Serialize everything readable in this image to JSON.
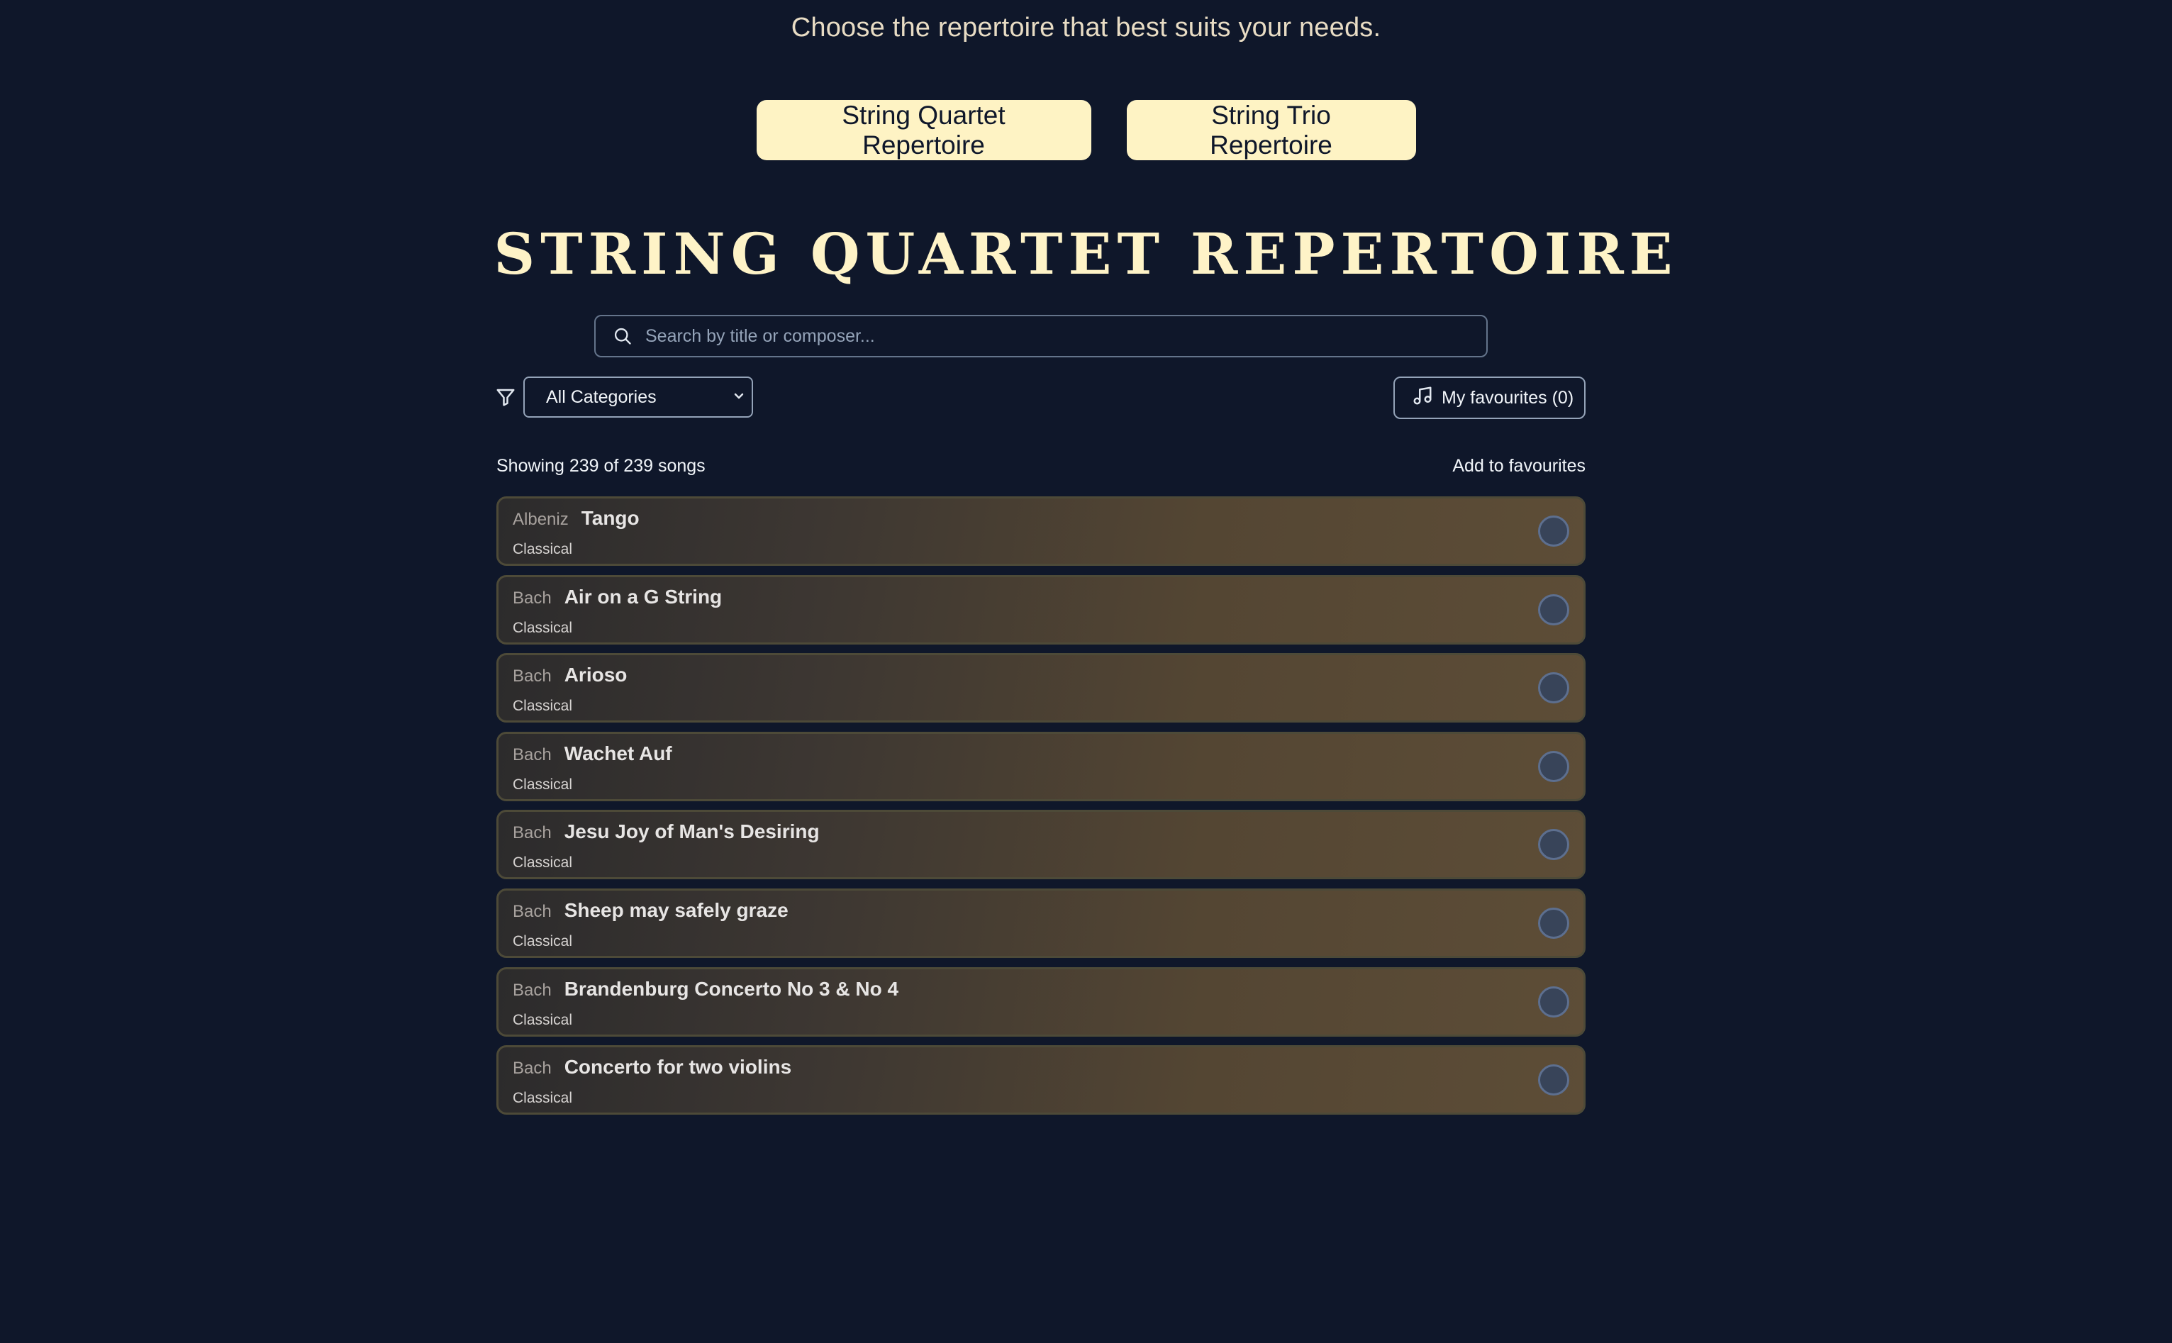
{
  "header": {
    "subtitle": "Choose the repertoire that best suits your needs."
  },
  "repertoire_buttons": [
    {
      "label": "String Quartet Repertoire"
    },
    {
      "label": "String Trio Repertoire"
    }
  ],
  "section": {
    "title": "STRING QUARTET REPERTOIRE"
  },
  "search": {
    "placeholder": "Search by title or composer...",
    "value": ""
  },
  "filter": {
    "icon": "filter-icon",
    "selected": "All Categories"
  },
  "favourites": {
    "icon": "music-note-icon",
    "label": "My favourites (0)"
  },
  "list": {
    "count_text": "Showing 239 of 239 songs",
    "add_to_favourites_label": "Add to favourites",
    "songs": [
      {
        "composer": "Albeniz",
        "title": "Tango",
        "category": "Classical"
      },
      {
        "composer": "Bach",
        "title": "Air on a G String",
        "category": "Classical"
      },
      {
        "composer": "Bach",
        "title": "Arioso",
        "category": "Classical"
      },
      {
        "composer": "Bach",
        "title": "Wachet Auf",
        "category": "Classical"
      },
      {
        "composer": "Bach",
        "title": "Jesu Joy of Man's Desiring",
        "category": "Classical"
      },
      {
        "composer": "Bach",
        "title": "Sheep may safely graze",
        "category": "Classical"
      },
      {
        "composer": "Bach",
        "title": "Brandenburg Concerto No 3 & No 4",
        "category": "Classical"
      },
      {
        "composer": "Bach",
        "title": "Concerto for two violins",
        "category": "Classical"
      }
    ]
  },
  "colors": {
    "background": "#0f172a",
    "accent": "#fef3c4",
    "row_gradient_end": "#5d4d37"
  }
}
